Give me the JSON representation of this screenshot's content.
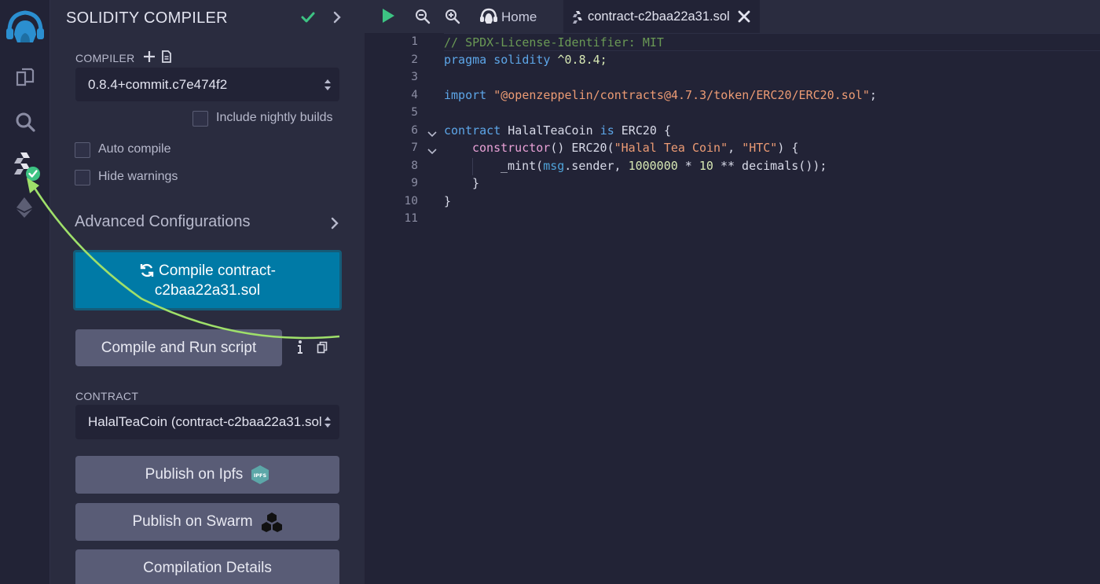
{
  "panel": {
    "title": "SOLIDITY COMPILER",
    "compiler_label": "COMPILER",
    "compiler_version": "0.8.4+commit.c7e474f2",
    "include_nightly_label": "Include nightly builds",
    "auto_compile_label": "Auto compile",
    "hide_warnings_label": "Hide warnings",
    "advanced_label": "Advanced Configurations",
    "compile_button_line1": "Compile contract-",
    "compile_button_line2": "c2baa22a31.sol",
    "compile_run_label": "Compile and Run script",
    "contract_label": "CONTRACT",
    "contract_selected": "HalalTeaCoin (contract-c2baa22a31.sol)",
    "publish_ipfs_label": "Publish on Ipfs",
    "ipfs_badge": "IPFS",
    "publish_swarm_label": "Publish on Swarm",
    "compilation_details_label": "Compilation Details"
  },
  "tabs": {
    "home_label": "Home",
    "file_label": "contract-c2baa22a31.sol"
  },
  "editor": {
    "line_numbers": [
      "1",
      "2",
      "3",
      "4",
      "5",
      "6",
      "7",
      "8",
      "9",
      "10",
      "11"
    ],
    "lines": {
      "l1": "// SPDX-License-Identifier: MIT",
      "l2_kw": "pragma solidity",
      "l2_rest": " ^0.8.4;",
      "l4_kw": "import",
      "l4_str": "\"@openzeppelin/contracts@4.7.3/token/ERC20/ERC20.sol\"",
      "l4_end": ";",
      "l6_kw": "contract",
      "l6_name": " HalalTeaCoin ",
      "l6_is": "is",
      "l6_rest": " ERC20 {",
      "l7_fn": "constructor",
      "l7_a": "() ERC20(",
      "l7_s1": "\"Halal Tea Coin\"",
      "l7_b": ", ",
      "l7_s2": "\"HTC\"",
      "l7_c": ") {",
      "l8_a": "_mint(",
      "l8_msg": "msg",
      "l8_b": ".sender, ",
      "l8_n1": "1000000",
      "l8_c": " * ",
      "l8_n2": "10",
      "l8_d": " ** decimals());",
      "l9": "}",
      "l10": "}"
    }
  },
  "colors": {
    "accent_green": "#3dc383",
    "primary_blue": "#007aa6",
    "annotation_arrow": "#9fe06a"
  }
}
